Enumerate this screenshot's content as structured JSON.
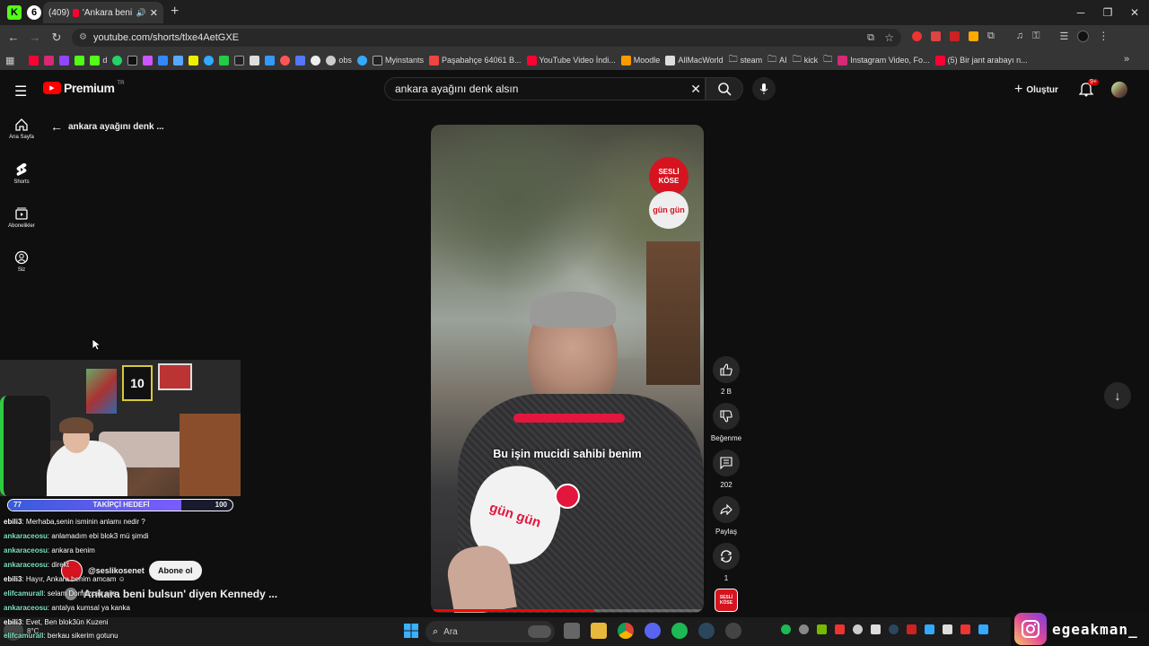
{
  "browser": {
    "tab_count": "(409)",
    "tab_title": "'Ankara beni buls",
    "url": "youtube.com/shorts/tlxe4AetGXE",
    "bookmarks": [
      "d",
      "obs",
      "Myinstants",
      "Paşabahçe 64061 B...",
      "YouTube Video İndi...",
      "Moodle",
      "AllMacWorld",
      "steam",
      "AI",
      "kick",
      "Instagram Video, Fo...",
      "(5) Bir jant arabayı n..."
    ]
  },
  "youtube": {
    "logo": "Premium",
    "region": "TR",
    "search_value": "ankara ayağını denk alsın",
    "create_label": "Oluştur",
    "notif_badge": "9+",
    "sidebar": [
      {
        "label": "Ana Sayfa",
        "icon": "home-icon"
      },
      {
        "label": "Shorts",
        "icon": "shorts-icon"
      },
      {
        "label": "Abonelikler",
        "icon": "subscriptions-icon"
      },
      {
        "label": "Siz",
        "icon": "user-icon"
      }
    ],
    "back_label": "ankara ayağını denk ...",
    "video": {
      "caption": "Bu işin mucidi sahibi benim",
      "channel": "@seslikosenet",
      "subscribe": "Abone ol",
      "title": "'Ankara beni bulsun' diyen Kennedy ...",
      "badge_top": "SESLİ",
      "badge_bottom": "KÖSE",
      "mic_brand": "gün gün"
    },
    "actions": {
      "likes": "2 B",
      "dislike": "Beğenme",
      "comments": "202",
      "share": "Paylaş",
      "remix": "1"
    }
  },
  "stream": {
    "goal_label": "TAKİPÇİ HEDEFİ",
    "goal_current": "77",
    "goal_target": "100",
    "goal_progress": 0.77,
    "jersey": "10",
    "chat": [
      {
        "user": "ebili3",
        "msg": ": Merhaba,senin isminin anlamı nedir ?",
        "color": "#ffffff"
      },
      {
        "user": "ankaraceosu",
        "msg": ": anlamadım ebi blok3 mü şimdi",
        "color": "#7fe0c6"
      },
      {
        "user": "ankaraceosu",
        "msg": ": ankara benim",
        "color": "#7fe0c6"
      },
      {
        "user": "ankaraceosu",
        "msg": ": direkt",
        "color": "#7fe0c6"
      },
      {
        "user": "ebili3",
        "msg": ": Hayır, Ankara benim amcam ☺",
        "color": "#ffffff"
      },
      {
        "user": "elifcamurall",
        "msg": ": selam Domuzcan aile",
        "color": "#7fe0c6"
      },
      {
        "user": "ankaraceosu",
        "msg": ": antalya kumsal ya kanka",
        "color": "#7fe0c6"
      },
      {
        "user": "ebili3",
        "msg": ": Evet, Ben blok3ün Kuzeni",
        "color": "#ffffff"
      },
      {
        "user": "elifcamurall",
        "msg": ": berkau sikerim gotunu",
        "color": "#7fe0c6"
      }
    ],
    "instagram_handle": "egeakman_"
  },
  "taskbar": {
    "search_placeholder": "Ara",
    "temp": "8°C"
  },
  "colors": {
    "yt_red": "#ff0000",
    "chat_green": "#7fe0c6",
    "goal_blue": "#3a5bd9"
  }
}
